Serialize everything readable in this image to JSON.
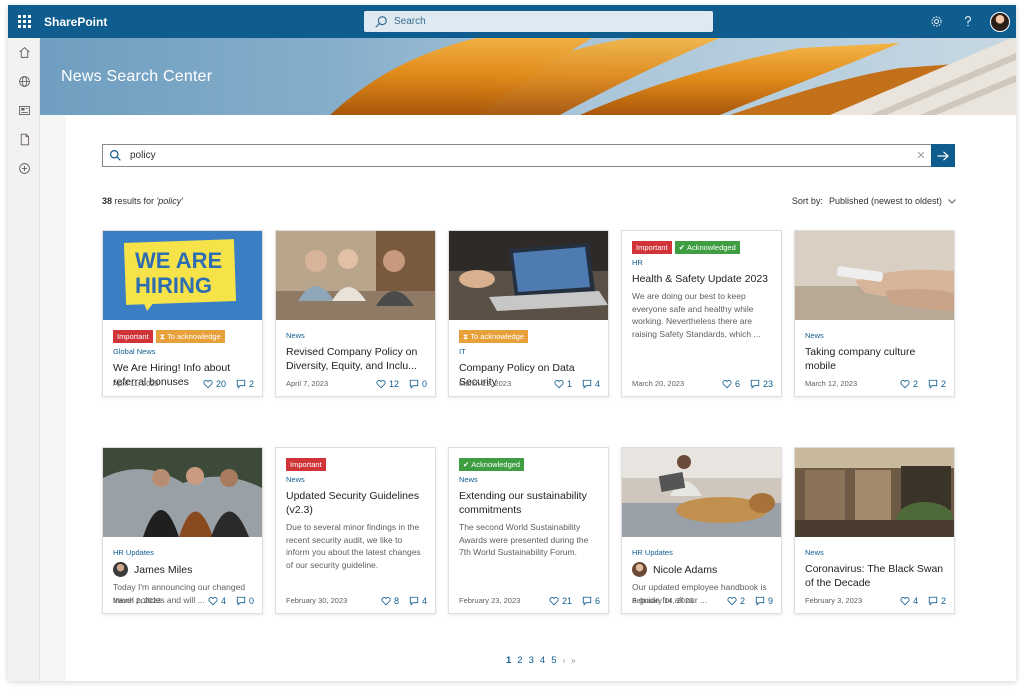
{
  "app": {
    "name": "SharePoint"
  },
  "topbar": {
    "search_placeholder": "Search",
    "icons": [
      "waffle-icon",
      "search-icon",
      "settings-icon",
      "help-icon",
      "avatar"
    ]
  },
  "rail": {
    "items": [
      "home-icon",
      "globe-icon",
      "news-icon",
      "document-icon",
      "add-icon"
    ]
  },
  "hero": {
    "title": "News Search Center"
  },
  "search": {
    "query": "policy",
    "clear": "✕"
  },
  "results": {
    "count": "38",
    "text": " results for ",
    "query": "'policy'"
  },
  "sort": {
    "label": "Sort by:",
    "value": "Published (newest to oldest)"
  },
  "colors": {
    "brand": "#0f5c8f",
    "important": "#d13438",
    "to_acknowledge": "#e8a03a",
    "acknowledged": "#3f9e42"
  },
  "cards": [
    {
      "badges": [
        "Important",
        "To acknowledge"
      ],
      "category": "Global News",
      "title": "We Are Hiring! Info about referral bonuses",
      "date": "April 11, 2023",
      "likes": "20",
      "comments": "2"
    },
    {
      "badges": [],
      "category": "News",
      "title": "Revised Company Policy on Diversity, Equity, and Inclu...",
      "date": "April 7, 2023",
      "likes": "12",
      "comments": "0"
    },
    {
      "badges": [
        "To acknowledge"
      ],
      "category": "IT",
      "title": "Company Policy on Data Security",
      "date": "March 22, 2023",
      "likes": "1",
      "comments": "4"
    },
    {
      "badges": [
        "Important",
        "Acknowledged"
      ],
      "category": "HR",
      "title": "Health & Safety Update 2023",
      "description": "We are doing our best to keep everyone safe and healthy while working. Nevertheless there are raising Safety Standards, which ...",
      "date": "March 20, 2023",
      "likes": "6",
      "comments": "23"
    },
    {
      "badges": [],
      "category": "News",
      "title": "Taking company culture mobile",
      "date": "March 12, 2023",
      "likes": "2",
      "comments": "2"
    },
    {
      "badges": [],
      "category": "HR Updates",
      "author": "James Miles",
      "description": "Today I'm announcing our changed travel policies and will ...",
      "date": "March 2, 2023",
      "likes": "4",
      "comments": "0"
    },
    {
      "badges": [
        "Important"
      ],
      "category": "News",
      "title": "Updated Security Guidelines (v2.3)",
      "description": "Due to several minor findings in the recent security audit, we like to inform you about the latest changes of our security guideline.",
      "date": "February 30, 2023",
      "likes": "8",
      "comments": "4"
    },
    {
      "badges": [
        "Acknowledged"
      ],
      "category": "News",
      "title": "Extending our sustainability commitments",
      "description": "The second World Sustainability Awards were presented during the 7th World Sustainability Forum.",
      "date": "February 23, 2023",
      "likes": "21",
      "comments": "6"
    },
    {
      "badges": [],
      "category": "HR Updates",
      "author": "Nicole Adams",
      "description": "Our updated employee handbook is a guide for all our ...",
      "date": "February 14, 2023",
      "likes": "2",
      "comments": "9"
    },
    {
      "badges": [],
      "category": "News",
      "title": "Coronavirus: The Black Swan of the Decade",
      "date": "February 3, 2023",
      "likes": "4",
      "comments": "2"
    }
  ],
  "hiring_image_text": [
    "WE ARE",
    "HIRING"
  ],
  "pager": {
    "pages": [
      "1",
      "2",
      "3",
      "4",
      "5"
    ],
    "next": "›",
    "last": "»"
  }
}
